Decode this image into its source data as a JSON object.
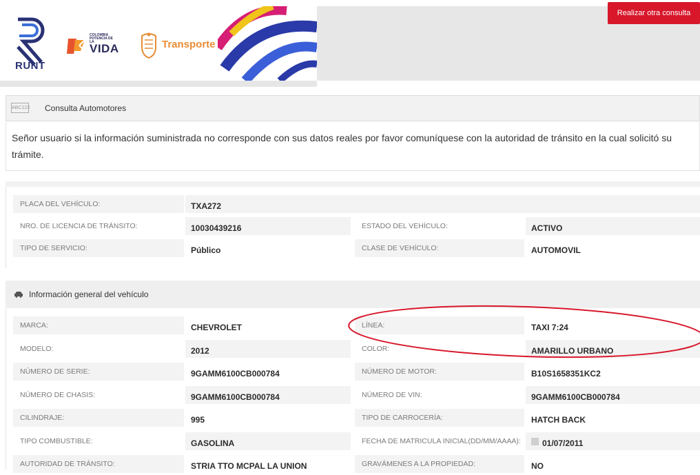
{
  "header": {
    "runt_label": "RUNT",
    "vida_small": "COLOMBIA POTENCIA DE LA",
    "vida_label": "VIDA",
    "transporte_label": "Transporte"
  },
  "consult": {
    "icon_text": "ABC123",
    "title": "Consulta Automotores",
    "button_label": "Realizar otra consulta"
  },
  "notice": "Señor usuario si la información suministrada no corresponde con sus datos reales por favor comuníquese con la autoridad de tránsito en la cual solicitó su trámite.",
  "summary": {
    "rows": [
      {
        "l1": "PLACA DEL VEHÍCULO:",
        "v1": "TXA272",
        "l2": "",
        "v2": ""
      },
      {
        "l1": "NRO. DE LICENCIA DE TRÁNSITO:",
        "v1": "10030439216",
        "l2": "ESTADO DEL VEHÍCULO:",
        "v2": "ACTIVO"
      },
      {
        "l1": "TIPO DE SERVICIO:",
        "v1": "Público",
        "l2": "CLASE DE VEHÍCULO:",
        "v2": "AUTOMOVIL"
      }
    ]
  },
  "general": {
    "title": "Información general del vehículo",
    "rows": [
      {
        "l1": "MARCA:",
        "v1": "CHEVROLET",
        "l2": "LÍNEA:",
        "v2": "TAXI 7:24"
      },
      {
        "l1": "MODELO:",
        "v1": "2012",
        "l2": "COLOR:",
        "v2": "AMARILLO URBANO"
      },
      {
        "l1": "NÚMERO DE SERIE:",
        "v1": "9GAMM6100CB000784",
        "l2": "NÚMERO DE MOTOR:",
        "v2": "B10S1658351KC2"
      },
      {
        "l1": "NÚMERO DE CHASIS:",
        "v1": "9GAMM6100CB000784",
        "l2": "NÚMERO DE VIN:",
        "v2": "9GAMM6100CB000784"
      },
      {
        "l1": "CILINDRAJE:",
        "v1": "995",
        "l2": "TIPO DE CARROCERÍA:",
        "v2": "HATCH BACK"
      },
      {
        "l1": "TIPO COMBUSTIBLE:",
        "v1": "GASOLINA",
        "l2": "FECHA DE MATRICULA INICIAL(DD/MM/AAAA):",
        "v2": "01/07/2011"
      },
      {
        "l1": "AUTORIDAD DE TRÁNSITO:",
        "v1": "STRIA TTO MCPAL LA UNION",
        "l2": "GRAVÁMENES A LA PROPIEDAD:",
        "v2": "NO"
      }
    ]
  },
  "colors": {
    "accent_red": "#d8172b",
    "runt_blue": "#2a3275",
    "transporte_orange": "#e88c35",
    "annotation_red": "#d8172b"
  }
}
